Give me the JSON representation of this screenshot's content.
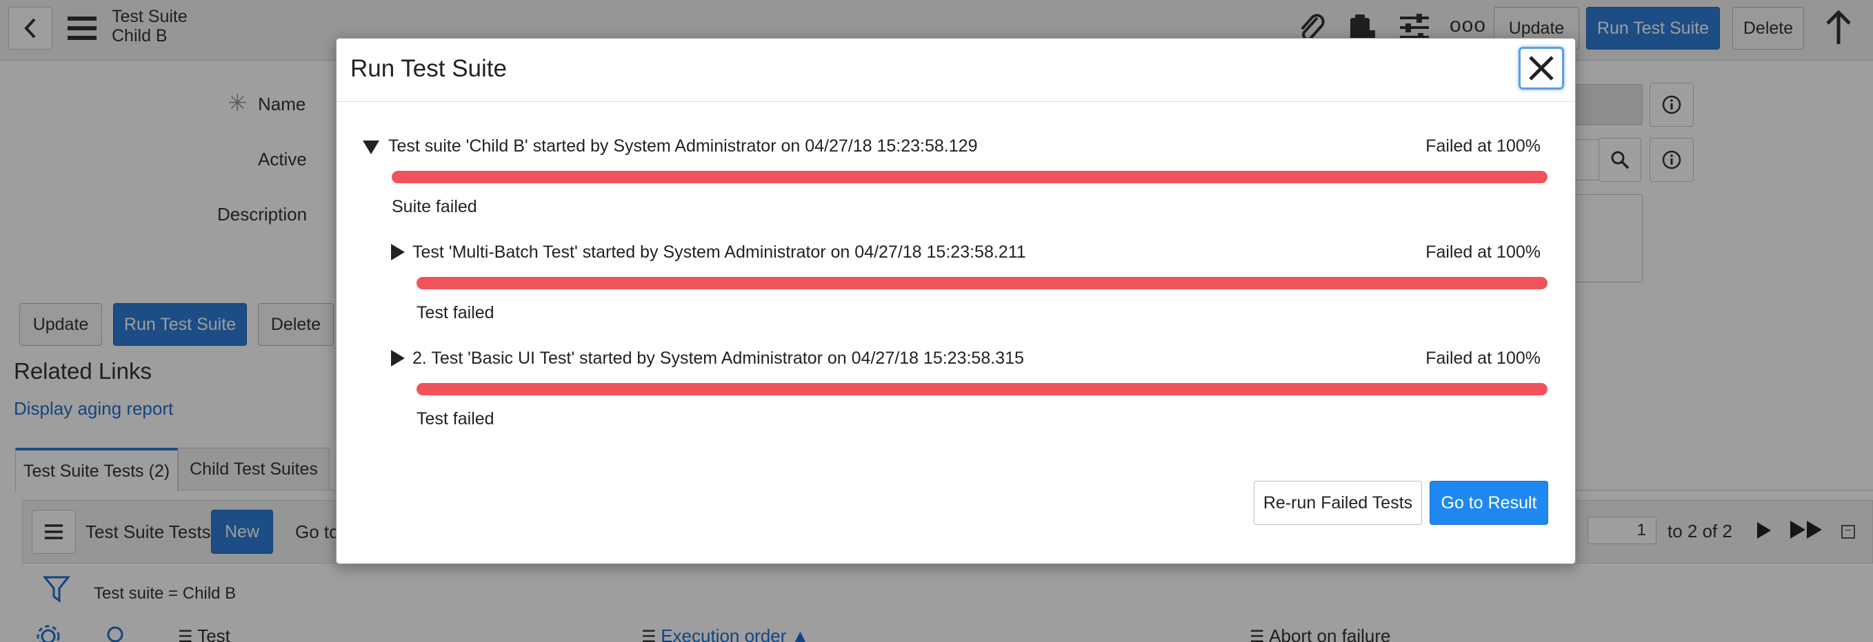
{
  "header": {
    "title": "Test Suite",
    "subtitle": "Child B",
    "update": "Update",
    "run": "Run Test Suite",
    "delete": "Delete",
    "more": "ooo"
  },
  "form": {
    "name_label": "Name",
    "active_label": "Active",
    "description_label": "Description"
  },
  "actions": {
    "update": "Update",
    "run": "Run Test Suite",
    "delete": "Delete"
  },
  "related": {
    "title": "Related Links",
    "link": "Display aging report"
  },
  "tabs": [
    "Test Suite Tests (2)",
    "Child Test Suites"
  ],
  "list": {
    "title": "Test Suite Tests",
    "new": "New",
    "goto": "Go to",
    "page": "1",
    "of": "to 2 of 2",
    "filter": "Test suite = Child B",
    "columns": [
      "Test",
      "Execution order",
      "Abort on failure"
    ]
  },
  "modal": {
    "title": "Run Test Suite",
    "suite": {
      "text": "Test suite 'Child B' started by System Administrator on 04/27/18 15:23:58.129",
      "status": "Failed at 100%",
      "progress": 1.0,
      "result": "Suite failed"
    },
    "tests": [
      {
        "text": "Test 'Multi-Batch Test' started by System Administrator on 04/27/18 15:23:58.211",
        "status": "Failed at 100%",
        "progress": 1.0,
        "result": "Test failed"
      },
      {
        "text": "2. Test 'Basic UI Test' started by System Administrator on 04/27/18 15:23:58.315",
        "status": "Failed at 100%",
        "progress": 1.0,
        "result": "Test failed"
      }
    ],
    "rerun": "Re-run Failed Tests",
    "goto": "Go to Result"
  },
  "colors": {
    "primary": "#2e7cd6",
    "failed": "#f0535b",
    "link": "#1f6fcf",
    "goResult": "#1e88f0"
  }
}
